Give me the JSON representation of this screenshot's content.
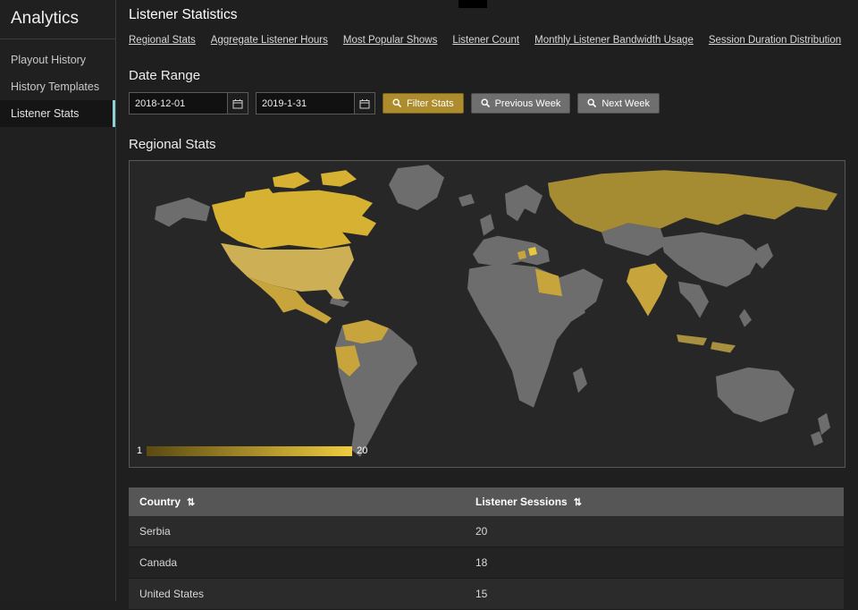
{
  "sidebar": {
    "title": "Analytics",
    "active_index": 2,
    "items": [
      {
        "label": "Playout History"
      },
      {
        "label": "History Templates"
      },
      {
        "label": "Listener Stats"
      }
    ]
  },
  "header": {
    "title": "Listener Statistics"
  },
  "nav": {
    "links": [
      {
        "label": "Regional Stats"
      },
      {
        "label": "Aggregate Listener Hours"
      },
      {
        "label": "Most Popular Shows"
      },
      {
        "label": "Listener Count"
      },
      {
        "label": "Monthly Listener Bandwidth Usage"
      },
      {
        "label": "Session Duration Distribution"
      }
    ]
  },
  "date_range": {
    "heading": "Date Range",
    "start_value": "2018-12-01",
    "end_value": "2019-1-31",
    "buttons": {
      "filter": "Filter Stats",
      "previous": "Previous Week",
      "next": "Next Week"
    }
  },
  "regional": {
    "heading": "Regional Stats",
    "legend": {
      "min": "1",
      "max": "20"
    }
  },
  "table": {
    "columns": [
      {
        "label": "Country"
      },
      {
        "label": "Listener Sessions"
      }
    ],
    "sort_icon": "⇅",
    "rows": [
      {
        "country": "Serbia",
        "sessions": "20"
      },
      {
        "country": "Canada",
        "sessions": "18"
      },
      {
        "country": "United States",
        "sessions": "15"
      }
    ]
  },
  "chart_data": {
    "type": "heatmap",
    "subtype": "world-choropleth",
    "title": "Regional Stats",
    "legend": {
      "min": 1,
      "max": 20,
      "gradient": [
        "#5a4a12",
        "#f0cc3e"
      ]
    },
    "countries": [
      {
        "name": "Serbia",
        "listener_sessions": 20
      },
      {
        "name": "Canada",
        "listener_sessions": 18
      },
      {
        "name": "United States",
        "listener_sessions": 15
      }
    ],
    "regions": [
      {
        "id": "alaska",
        "color": "#6d6d6d"
      },
      {
        "id": "canada",
        "color": "#d7b232"
      },
      {
        "id": "greenland",
        "color": "#6d6d6d"
      },
      {
        "id": "usa",
        "color": "#cdb055"
      },
      {
        "id": "mexico",
        "color": "#c7a53c"
      },
      {
        "id": "cuba",
        "color": "#6d6d6d"
      },
      {
        "id": "south-america",
        "color": "#6d6d6d"
      },
      {
        "id": "south-america-north",
        "color": "#c7a53c"
      },
      {
        "id": "peru",
        "color": "#c7a53c"
      },
      {
        "id": "iceland",
        "color": "#6d6d6d"
      },
      {
        "id": "uk",
        "color": "#6d6d6d"
      },
      {
        "id": "scandinavia",
        "color": "#6d6d6d"
      },
      {
        "id": "europe",
        "color": "#6d6d6d"
      },
      {
        "id": "serbia",
        "color": "#e8c83e"
      },
      {
        "id": "balkans",
        "color": "#c7a53c"
      },
      {
        "id": "africa",
        "color": "#6d6d6d"
      },
      {
        "id": "egypt",
        "color": "#c7a53c"
      },
      {
        "id": "madagascar",
        "color": "#6d6d6d"
      },
      {
        "id": "middle-east",
        "color": "#6d6d6d"
      },
      {
        "id": "russia",
        "color": "#a58c32"
      },
      {
        "id": "central-asia",
        "color": "#6d6d6d"
      },
      {
        "id": "china",
        "color": "#6d6d6d"
      },
      {
        "id": "india",
        "color": "#c7a53c"
      },
      {
        "id": "se-asia",
        "color": "#6d6d6d"
      },
      {
        "id": "indonesia",
        "color": "#a89040"
      },
      {
        "id": "philippines",
        "color": "#6d6d6d"
      },
      {
        "id": "japan",
        "color": "#6d6d6d"
      },
      {
        "id": "australia",
        "color": "#6d6d6d"
      },
      {
        "id": "new-zealand",
        "color": "#6d6d6d"
      }
    ]
  },
  "colors": {
    "page_bg": "#1f1f1f",
    "accent_gold": "#ac8c2c",
    "button_gray": "#6f6f6f",
    "table_header_bg": "#565656",
    "active_item_accent": "#8fd0da",
    "land_default": "#6d6d6d"
  }
}
